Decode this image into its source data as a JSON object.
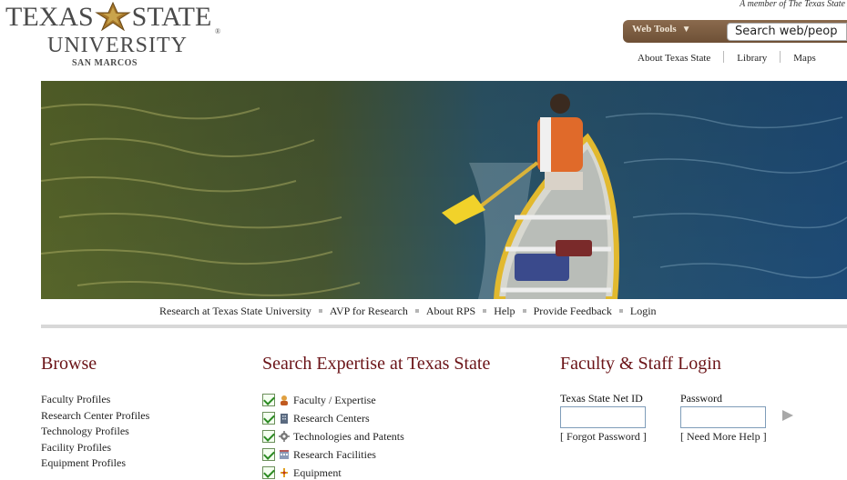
{
  "header": {
    "logo_left": "TEXAS",
    "logo_right": "STATE",
    "logo_reg": "®",
    "logo_university": "UNIVERSITY",
    "logo_campus": "SAN MARCOS",
    "member_text": "A member of The Texas State",
    "web_tools_label": "Web Tools",
    "search_placeholder": "Search web/peop",
    "top_links": [
      "About Texas State",
      "Library",
      "Maps"
    ]
  },
  "nav": {
    "items": [
      "Research at Texas State University",
      "AVP for Research",
      "About RPS",
      "Help",
      "Provide Feedback",
      "Login"
    ]
  },
  "browse": {
    "title": "Browse",
    "items": [
      "Faculty Profiles",
      "Research Center Profiles",
      "Technology Profiles",
      "Facility Profiles",
      "Equipment Profiles"
    ]
  },
  "search_expertise": {
    "title": "Search Expertise at Texas State",
    "items": [
      {
        "label": "Faculty / Expertise",
        "icon": "person-icon",
        "checked": true
      },
      {
        "label": "Research Centers",
        "icon": "building-icon",
        "checked": true
      },
      {
        "label": "Technologies and Patents",
        "icon": "gear-icon",
        "checked": true
      },
      {
        "label": "Research Facilities",
        "icon": "facility-icon",
        "checked": true
      },
      {
        "label": "Equipment",
        "icon": "equipment-icon",
        "checked": true
      }
    ]
  },
  "login": {
    "title": "Faculty & Staff Login",
    "netid_label": "Texas State Net ID",
    "password_label": "Password",
    "forgot_link": "[ Forgot Password ]",
    "help_link": "[ Need More Help ]"
  },
  "colors": {
    "maroon": "#6b1418",
    "gold": "#c9a44c",
    "brown": "#6e5036"
  }
}
